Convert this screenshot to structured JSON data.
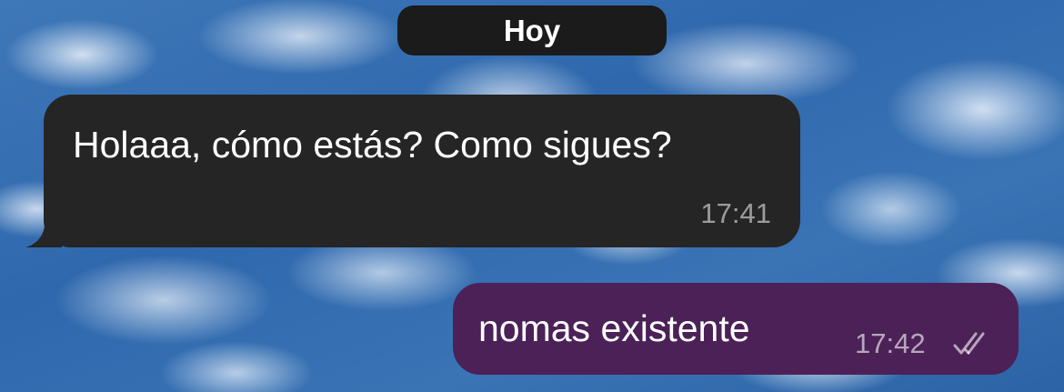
{
  "chat": {
    "date_separator": "Hoy",
    "messages": [
      {
        "direction": "incoming",
        "text": "Holaaa, cómo estás? Como sigues?",
        "time": "17:41"
      },
      {
        "direction": "outgoing",
        "text": "nomas existente",
        "time": "17:42",
        "status_icon": "double-check-icon"
      }
    ]
  },
  "colors": {
    "incoming_bubble": "#252525",
    "outgoing_bubble": "#4b2157",
    "date_chip": "#1b1b1b"
  }
}
